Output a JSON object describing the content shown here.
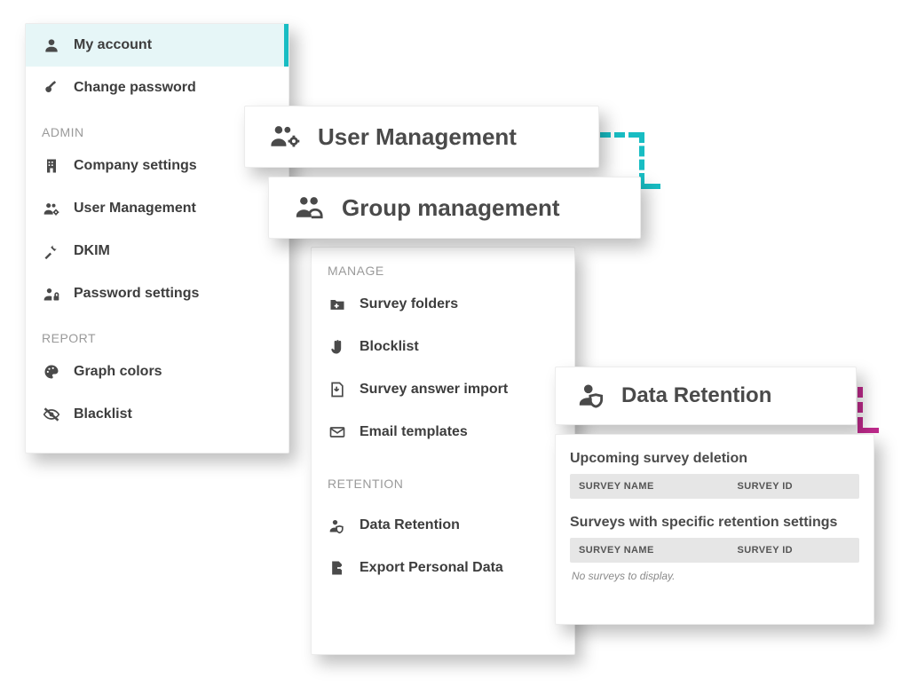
{
  "menuLeft": {
    "items": [
      {
        "label": "My account"
      },
      {
        "label": "Change password"
      }
    ],
    "sections": [
      {
        "title": "ADMIN",
        "items": [
          {
            "label": "Company settings"
          },
          {
            "label": "User Management"
          },
          {
            "label": "DKIM"
          },
          {
            "label": "Password settings"
          }
        ]
      },
      {
        "title": "REPORT",
        "items": [
          {
            "label": "Graph colors"
          },
          {
            "label": "Blacklist"
          }
        ]
      }
    ]
  },
  "menuRight": {
    "sections": [
      {
        "title": "MANAGE",
        "items": [
          {
            "label": "Survey folders"
          },
          {
            "label": "Blocklist"
          },
          {
            "label": "Survey answer import"
          },
          {
            "label": "Email templates"
          }
        ]
      },
      {
        "title": "RETENTION",
        "items": [
          {
            "label": "Data Retention"
          },
          {
            "label": "Export Personal Data"
          }
        ]
      }
    ]
  },
  "cards": {
    "user": "User Management",
    "group": "Group management",
    "retention": "Data Retention"
  },
  "retentionPanel": {
    "heading1": "Upcoming survey deletion",
    "heading2": "Surveys with specific retention settings",
    "col1": "SURVEY NAME",
    "col2": "SURVEY ID",
    "empty": "No surveys to display."
  }
}
